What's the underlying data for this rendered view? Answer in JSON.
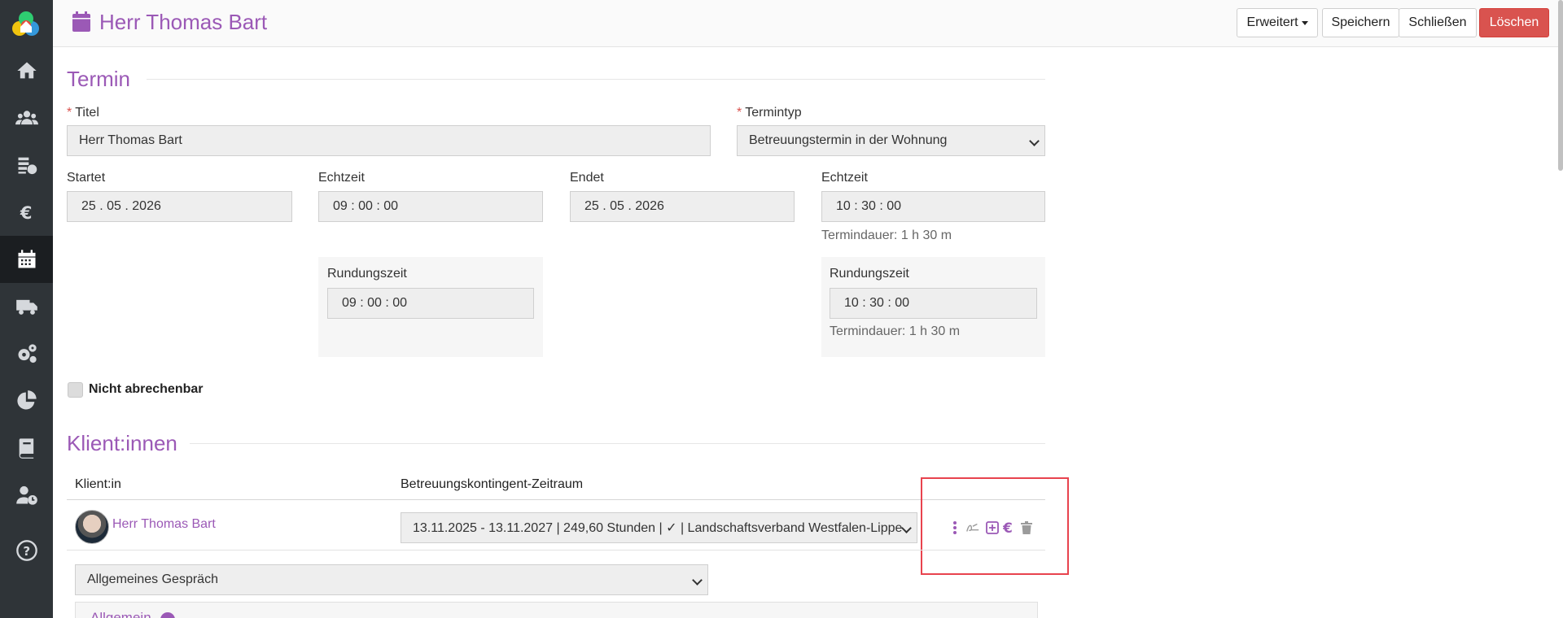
{
  "header": {
    "title": "Herr Thomas Bart",
    "buttons": {
      "erweitert": "Erweitert",
      "speichern": "Speichern",
      "schliessen": "Schließen",
      "loeschen": "Löschen"
    }
  },
  "sidebar": {
    "items": [
      {
        "icon": "home-icon"
      },
      {
        "icon": "users-icon"
      },
      {
        "icon": "documents-icon"
      },
      {
        "icon": "euro-icon"
      },
      {
        "icon": "calendar-icon",
        "active": true
      },
      {
        "icon": "truck-icon"
      },
      {
        "icon": "gears-icon"
      },
      {
        "icon": "chart-pie-icon"
      },
      {
        "icon": "book-icon"
      },
      {
        "icon": "user-clock-icon"
      },
      {
        "icon": "help-icon"
      }
    ]
  },
  "termin": {
    "section_title": "Termin",
    "titel_label": "Titel",
    "titel_value": "Herr Thomas Bart",
    "termintyp_label": "Termintyp",
    "termintyp_value": "Betreuungstermin in der Wohnung",
    "startet_label": "Startet",
    "startet_value": "25 . 05 . 2026",
    "echtzeit_label": "Echtzeit",
    "start_time_value": "09 : 00 : 00",
    "endet_label": "Endet",
    "endet_value": "25 . 05 . 2026",
    "end_time_value": "10 : 30 : 00",
    "termindauer_text": "Termindauer: 1 h 30 m",
    "rundungszeit_label": "Rundungszeit",
    "rund_start_value": "09 : 00 : 00",
    "rund_end_value": "10 : 30 : 00",
    "nicht_abrechenbar": "Nicht abrechenbar"
  },
  "klienten": {
    "section_title": "Klient:innen",
    "col_klient": "Klient:in",
    "col_kontingent": "Betreuungskontingent-Zeitraum",
    "rows": [
      {
        "name": "Herr Thomas Bart",
        "kontingent": "13.11.2025 - 13.11.2027 | 249,60 Stunden | ✓ | Landschaftsverband Westfalen-Lippe"
      }
    ],
    "gespraech_value": "Allgemeines Gespräch",
    "accordion_label": "Allgemein"
  },
  "colors": {
    "accent": "#9b59b6",
    "danger": "#d9534f",
    "highlight": "#e8434e",
    "sidebar": "#2f3438"
  }
}
